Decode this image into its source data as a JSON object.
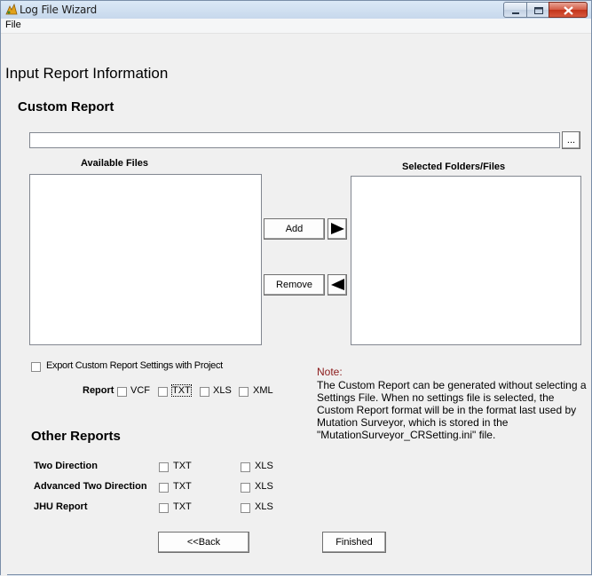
{
  "window": {
    "title": "Log File Wizard"
  },
  "menu": {
    "file": "File"
  },
  "page_title": "Input Report Information",
  "custom_report": {
    "heading": "Custom Report",
    "path_value": "",
    "browse_label": "...",
    "available_label": "Available Files",
    "selected_label": "Selected Folders/Files",
    "add_label": "Add",
    "remove_label": "Remove",
    "export_label": "Export Custom Report Settings with Project",
    "report_label": "Report",
    "formats": [
      "VCF",
      "TXT",
      "XLS",
      "XML"
    ]
  },
  "note": {
    "title": "Note:",
    "body": "The Custom Report can be generated without selecting a Settings File. When no settings file is selected, the Custom Report format will be in the format last used by Mutation Surveyor, which is stored in the \"MutationSurveyor_CRSetting.ini\" file."
  },
  "other_reports": {
    "heading": "Other Reports",
    "rows": [
      {
        "label": "Two Direction",
        "opt1": "TXT",
        "opt2": "XLS"
      },
      {
        "label": "Advanced Two Direction",
        "opt1": "TXT",
        "opt2": "XLS"
      },
      {
        "label": "JHU Report",
        "opt1": "TXT",
        "opt2": "XLS"
      }
    ]
  },
  "nav": {
    "back_label": "<<Back",
    "finish_label": "Finished"
  },
  "icons": [
    "app-icon",
    "minimize-icon",
    "maximize-icon",
    "close-icon",
    "arrow-right-icon",
    "arrow-left-icon"
  ]
}
